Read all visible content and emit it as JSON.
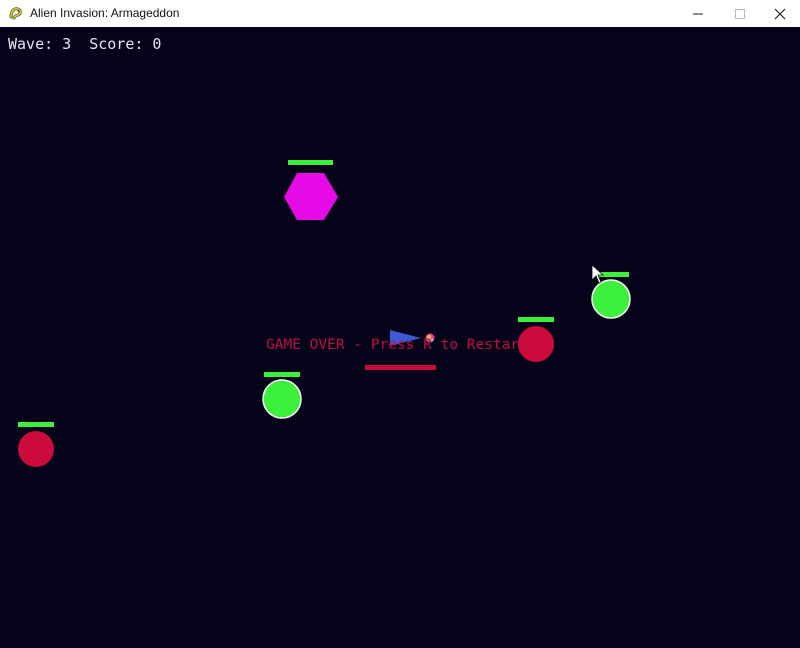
{
  "window": {
    "title": "Alien Invasion: Armageddon",
    "icon": "pygame-snake-icon"
  },
  "hud": {
    "wave_label": "Wave: 3",
    "score_label": "Score: 0",
    "wave": 3,
    "score": 0
  },
  "game_over_message": "GAME OVER - Press R to Restart",
  "colors": {
    "background": "#05031a",
    "health_bar": "#3cf03c",
    "green_enemy": "#3cf03c",
    "red_enemy": "#cc0a3c",
    "magenta_enemy": "#e60be6",
    "player_ship": "#3c5ad2",
    "player_health": "#cc0a3c",
    "game_over_text": "#c0103f"
  },
  "entities": [
    {
      "name": "magenta-hexagon-enemy",
      "kind": "hexagon",
      "color": "magenta"
    },
    {
      "name": "green-circle-enemy",
      "kind": "circle",
      "color": "green"
    },
    {
      "name": "red-circle-enemy",
      "kind": "circle",
      "color": "red"
    },
    {
      "name": "green-circle-enemy",
      "kind": "circle",
      "color": "green"
    },
    {
      "name": "red-circle-enemy",
      "kind": "circle",
      "color": "red"
    }
  ],
  "player": {
    "name": "player-ship",
    "shape": "triangle"
  }
}
